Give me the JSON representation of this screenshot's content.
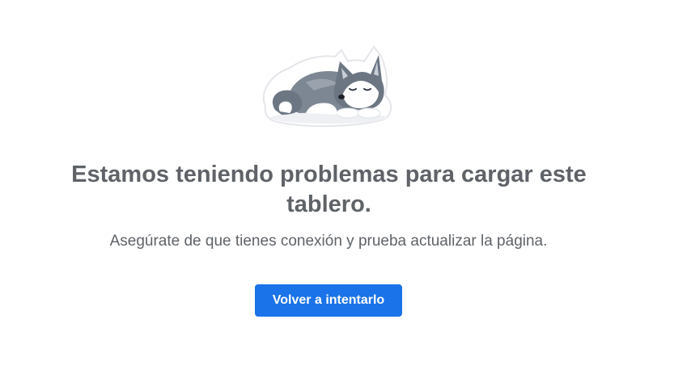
{
  "error": {
    "illustration": "sleeping-husky-icon",
    "title": "Estamos teniendo problemas para cargar este tablero.",
    "message": "Asegúrate de que tienes conexión y prueba actualizar la página.",
    "retry_label": "Volver a intentarlo"
  },
  "colors": {
    "text": "#5f6368",
    "button": "#1a73e8",
    "button_text": "#ffffff",
    "background": "#ffffff"
  }
}
